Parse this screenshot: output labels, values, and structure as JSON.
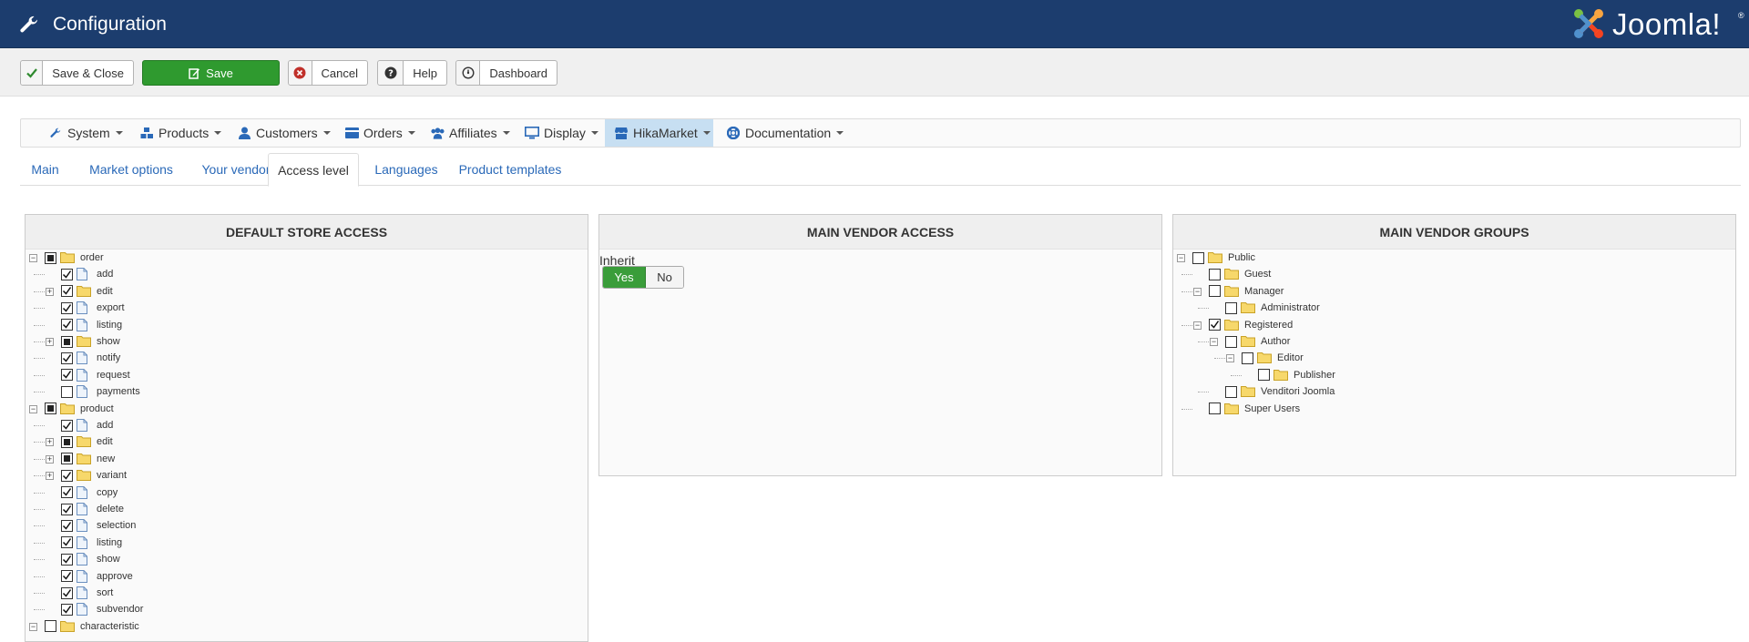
{
  "header": {
    "title": "Configuration",
    "logo_text": "Joomla!",
    "logo_reg": "®"
  },
  "toolbar": {
    "save_close": "Save & Close",
    "save": "Save",
    "cancel": "Cancel",
    "help": "Help",
    "dashboard": "Dashboard"
  },
  "menu": {
    "items": [
      {
        "label": "System",
        "icon": "wrench-icon"
      },
      {
        "label": "Products",
        "icon": "cubes-icon"
      },
      {
        "label": "Customers",
        "icon": "user-icon"
      },
      {
        "label": "Orders",
        "icon": "card-icon"
      },
      {
        "label": "Affiliates",
        "icon": "users-icon"
      },
      {
        "label": "Display",
        "icon": "monitor-icon"
      },
      {
        "label": "HikaMarket",
        "icon": "store-icon"
      },
      {
        "label": "Documentation",
        "icon": "lifebuoy-icon"
      }
    ],
    "active": "HikaMarket"
  },
  "tabs": {
    "items": [
      "Main",
      "Market options",
      "Your vendor",
      "Access level",
      "Languages",
      "Product templates"
    ],
    "active": "Access level"
  },
  "panels": {
    "store": {
      "title": "DEFAULT STORE ACCESS",
      "rows": [
        {
          "label": "order",
          "level": 0,
          "type": "folder",
          "state": "partial",
          "toggle": "minus"
        },
        {
          "label": "add",
          "level": 1,
          "type": "file",
          "state": "checked"
        },
        {
          "label": "edit",
          "level": 1,
          "type": "folder",
          "state": "checked",
          "toggle": "plus"
        },
        {
          "label": "export",
          "level": 1,
          "type": "file",
          "state": "checked"
        },
        {
          "label": "listing",
          "level": 1,
          "type": "file",
          "state": "checked"
        },
        {
          "label": "show",
          "level": 1,
          "type": "folder",
          "state": "partial",
          "toggle": "plus"
        },
        {
          "label": "notify",
          "level": 1,
          "type": "file",
          "state": "checked"
        },
        {
          "label": "request",
          "level": 1,
          "type": "file",
          "state": "checked"
        },
        {
          "label": "payments",
          "level": 1,
          "type": "file",
          "state": "unchecked"
        },
        {
          "label": "product",
          "level": 0,
          "type": "folder",
          "state": "partial",
          "toggle": "minus"
        },
        {
          "label": "add",
          "level": 1,
          "type": "file",
          "state": "checked"
        },
        {
          "label": "edit",
          "level": 1,
          "type": "folder",
          "state": "partial",
          "toggle": "plus"
        },
        {
          "label": "new",
          "level": 1,
          "type": "folder",
          "state": "partial",
          "toggle": "plus"
        },
        {
          "label": "variant",
          "level": 1,
          "type": "folder",
          "state": "checked",
          "toggle": "plus"
        },
        {
          "label": "copy",
          "level": 1,
          "type": "file",
          "state": "checked"
        },
        {
          "label": "delete",
          "level": 1,
          "type": "file",
          "state": "checked"
        },
        {
          "label": "selection",
          "level": 1,
          "type": "file",
          "state": "checked"
        },
        {
          "label": "listing",
          "level": 1,
          "type": "file",
          "state": "checked"
        },
        {
          "label": "show",
          "level": 1,
          "type": "file",
          "state": "checked"
        },
        {
          "label": "approve",
          "level": 1,
          "type": "file",
          "state": "checked"
        },
        {
          "label": "sort",
          "level": 1,
          "type": "file",
          "state": "checked"
        },
        {
          "label": "subvendor",
          "level": 1,
          "type": "file",
          "state": "checked"
        },
        {
          "label": "characteristic",
          "level": 0,
          "type": "folder",
          "state": "unchecked",
          "toggle": "minus"
        }
      ]
    },
    "vendor": {
      "title": "MAIN VENDOR ACCESS",
      "inherit_label": "Inherit",
      "yes": "Yes",
      "no": "No",
      "selected": "Yes"
    },
    "groups": {
      "title": "MAIN VENDOR GROUPS",
      "rows": [
        {
          "label": "Public",
          "level": 0,
          "state": "unchecked",
          "toggle": "minus"
        },
        {
          "label": "Guest",
          "level": 1,
          "state": "unchecked"
        },
        {
          "label": "Manager",
          "level": 1,
          "state": "unchecked",
          "toggle": "minus"
        },
        {
          "label": "Administrator",
          "level": 2,
          "state": "unchecked"
        },
        {
          "label": "Registered",
          "level": 1,
          "state": "checked",
          "toggle": "minus"
        },
        {
          "label": "Author",
          "level": 2,
          "state": "unchecked",
          "toggle": "minus"
        },
        {
          "label": "Editor",
          "level": 3,
          "state": "unchecked",
          "toggle": "minus"
        },
        {
          "label": "Publisher",
          "level": 4,
          "state": "unchecked"
        },
        {
          "label": "Venditori Joomla",
          "level": 2,
          "state": "unchecked"
        },
        {
          "label": "Super Users",
          "level": 1,
          "state": "unchecked"
        }
      ]
    }
  }
}
